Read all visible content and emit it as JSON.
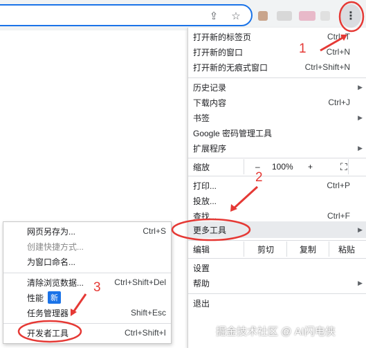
{
  "main_menu": {
    "new_tab": {
      "label": "打开新的标签页",
      "shortcut": "Ctrl+T"
    },
    "new_window": {
      "label": "打开新的窗口",
      "shortcut": "Ctrl+N"
    },
    "new_incognito": {
      "label": "打开新的无痕式窗口",
      "shortcut": "Ctrl+Shift+N"
    },
    "history": {
      "label": "历史记录"
    },
    "downloads": {
      "label": "下载内容",
      "shortcut": "Ctrl+J"
    },
    "bookmarks": {
      "label": "书签"
    },
    "passwords": {
      "label": "Google 密码管理工具"
    },
    "extensions": {
      "label": "扩展程序"
    },
    "zoom": {
      "label": "缩放",
      "minus": "–",
      "value": "100%",
      "plus": "+"
    },
    "print": {
      "label": "打印...",
      "shortcut": "Ctrl+P"
    },
    "cast": {
      "label": "投放..."
    },
    "find": {
      "label": "查找...",
      "shortcut": "Ctrl+F"
    },
    "more_tools": {
      "label": "更多工具"
    },
    "edit": {
      "label": "编辑",
      "cut": "剪切",
      "copy": "复制",
      "paste": "粘贴"
    },
    "settings": {
      "label": "设置"
    },
    "help": {
      "label": "帮助"
    },
    "exit": {
      "label": "退出"
    }
  },
  "submenu": {
    "save_page": {
      "label": "网页另存为...",
      "shortcut": "Ctrl+S"
    },
    "create_shortcut": {
      "label": "创建快捷方式..."
    },
    "name_window": {
      "label": "为窗口命名..."
    },
    "clear_data": {
      "label": "清除浏览数据...",
      "shortcut": "Ctrl+Shift+Del"
    },
    "performance": {
      "label": "性能",
      "badge": "新"
    },
    "task_manager": {
      "label": "任务管理器",
      "shortcut": "Shift+Esc"
    },
    "dev_tools": {
      "label": "开发者工具",
      "shortcut": "Ctrl+Shift+I"
    }
  },
  "annotations": {
    "step1": "1",
    "step2": "2",
    "step3": "3",
    "color": "#e53935"
  },
  "watermark": "掘金技术社区 @ AI闪电侠",
  "colors": {
    "accent": "#1a73e8",
    "highlight": "#e8eaed"
  }
}
